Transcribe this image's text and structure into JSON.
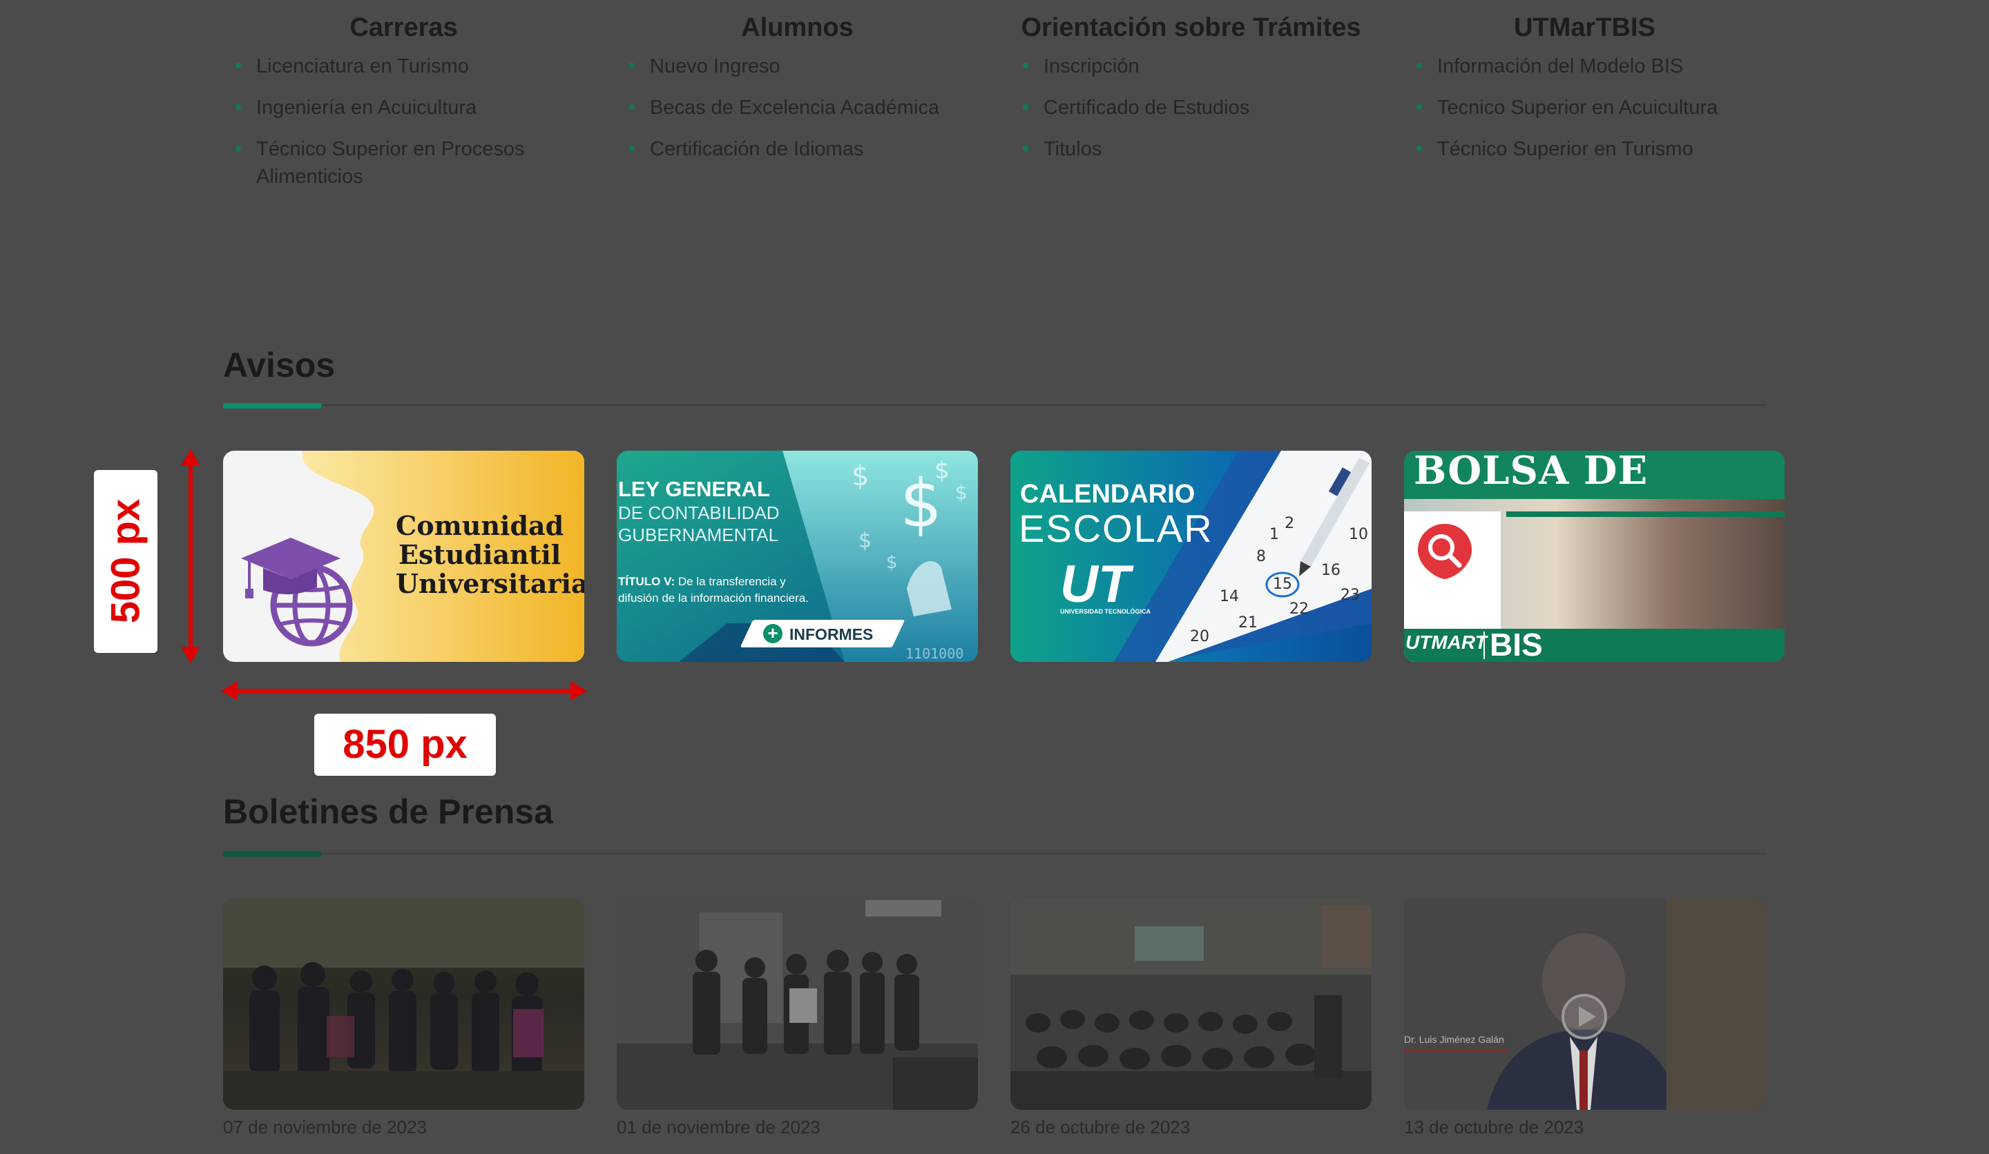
{
  "columns": [
    {
      "title": "Carreras",
      "items": [
        "Licenciatura en Turismo",
        "Ingeniería en Acuicultura",
        "Técnico Superior en Procesos Alimenticios"
      ]
    },
    {
      "title": "Alumnos",
      "items": [
        "Nuevo Ingreso",
        "Becas de Excelencia Académica",
        "Certificación de Idiomas"
      ]
    },
    {
      "title": "Orientación sobre Trámites",
      "items": [
        "Inscripción",
        "Certificado de Estudios",
        "Titulos"
      ]
    },
    {
      "title": "UTMarTBIS",
      "items": [
        "Información del Modelo BIS",
        "Tecnico Superior en Acuicultura",
        "Técnico Superior en Turismo"
      ]
    }
  ],
  "avisos": {
    "title": "Avisos",
    "cards": [
      {
        "heading": [
          "Comunidad",
          "Estudiantil",
          "Universitaria"
        ]
      },
      {
        "heading_bold": "LEY GENERAL",
        "heading_light": [
          "DE CONTABILIDAD",
          "GUBERNAMENTAL"
        ],
        "body_bold": "TÍTULO V:",
        "body": [
          "De la transferencia y",
          "difusión de la información financiera."
        ],
        "button": "INFORMES",
        "binary": "1101000"
      },
      {
        "heading_bold": "CALENDARIO",
        "heading_light": "ESCOLAR",
        "logo_text": "UT",
        "logo_caption": "UNIVERSIDAD TECNOLÓGICA",
        "days": [
          "1",
          "2",
          "8",
          "10",
          "14",
          "15",
          "16",
          "20",
          "21",
          "22",
          "23"
        ]
      },
      {
        "heading": "BOLSA DE TRABAJO",
        "logo_left": "UTMART",
        "logo_right": "BIS"
      }
    ]
  },
  "annotations": {
    "height_label": "500 px",
    "width_label": "850 px"
  },
  "boletines": {
    "title": "Boletines de Prensa",
    "items": [
      {
        "date": "07 de noviembre de 2023"
      },
      {
        "date": "01 de noviembre de 2023"
      },
      {
        "date": "26 de octubre de 2023"
      },
      {
        "date": "13 de octubre de 2023",
        "overlay": "Dr. Luis Jiménez Galán"
      }
    ]
  },
  "colors": {
    "accent": "#0b8f6b",
    "annotation": "#e00000",
    "overlay_bg": "#4b4b4b"
  },
  "icons": [
    "graduation-cap-icon",
    "globe-icon",
    "dollar-icon",
    "plus-circle-icon",
    "pen-icon",
    "search-icon",
    "play-icon"
  ]
}
